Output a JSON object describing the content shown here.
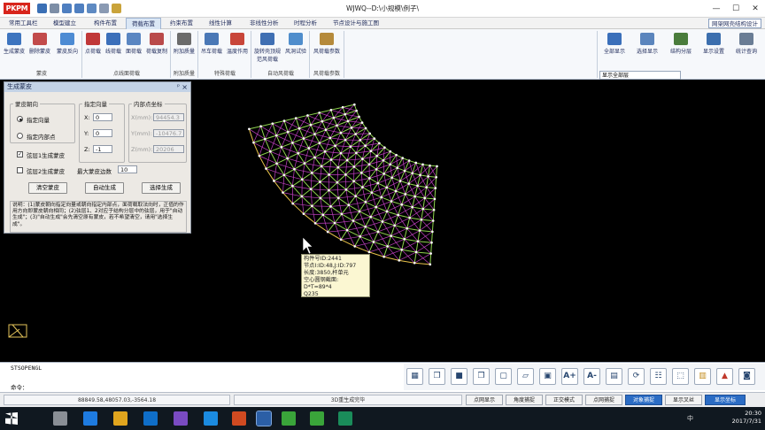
{
  "app": {
    "logo_text": "PKPM",
    "title": "WJWQ--D:\\小规模\\例子\\",
    "min": "—",
    "max": "☐",
    "close": "✕"
  },
  "menu": {
    "tabs": [
      "常用工具栏",
      "模型建立",
      "构件布置",
      "荷载布置",
      "约束布置",
      "线性计算",
      "非线性分析",
      "时程分析",
      "节点设计与施工图"
    ],
    "right_label": "网架网壳结构设计"
  },
  "ribbon": {
    "buttons": [
      {
        "label": "生成蒙皮",
        "icon": "skin-generate-icon"
      },
      {
        "label": "删除蒙皮",
        "icon": "skin-delete-icon"
      },
      {
        "label": "蒙皮反向",
        "icon": "skin-reverse-icon"
      },
      {
        "label": "点荷载",
        "icon": "point-load-icon"
      },
      {
        "label": "线荷载",
        "icon": "line-load-icon"
      },
      {
        "label": "面荷载",
        "icon": "area-load-icon"
      },
      {
        "label": "荷载复制",
        "icon": "load-copy-icon"
      },
      {
        "label": "附加质量",
        "icon": "mass-icon"
      },
      {
        "label": "吊车荷载",
        "icon": "crane-load-icon"
      },
      {
        "label": "温度作用",
        "icon": "temperature-icon"
      },
      {
        "label": "旋转壳顶规范风荷载",
        "icon": "wind-shell-icon"
      },
      {
        "label": "风洞试验",
        "icon": "wind-tunnel-icon"
      },
      {
        "label": "风荷载参数",
        "icon": "wind-param-icon"
      }
    ],
    "groups": [
      "蒙皮",
      "点线面荷载",
      "附加质量",
      "特殊荷载",
      "自动风荷载",
      "风荷载参数"
    ],
    "right_buttons": [
      {
        "label": "全部显示",
        "icon": "show-all-icon"
      },
      {
        "label": "选择显示",
        "icon": "select-show-icon"
      },
      {
        "label": "结构分层",
        "icon": "layer-icon"
      },
      {
        "label": "显示设置",
        "icon": "display-settings-icon"
      },
      {
        "label": "统计查询",
        "icon": "stats-icon"
      }
    ],
    "display_combo": "显示全部层"
  },
  "dialog": {
    "title": "生成蒙皮",
    "pin": "ᵖ",
    "close": "×",
    "direction_group": "蒙皮朝向",
    "opt_specified_dir": "指定向量",
    "opt_inner_point": "指定内部点",
    "vector_group": "指定向量",
    "x_label": "X:",
    "x_value": "0",
    "y_label": "Y:",
    "y_value": "0",
    "z_label": "Z:",
    "z_value": "-1",
    "inner_group": "内部点坐标",
    "ix_label": "X(mm):",
    "ix_value": "94454.3",
    "iy_label": "Y(mm):",
    "iy_value": "-10476.7",
    "iz_label": "Z(mm):",
    "iz_value": "20206",
    "chk_layer1": "弦层1生成蒙皮",
    "chk_layer2": "弦层2生成蒙皮",
    "max_edges_label": "最大蒙皮边数",
    "max_edges_value": "10",
    "btn_clear": "清空蒙皮",
    "btn_auto": "自动生成",
    "btn_select": "选择生成",
    "note": "说明：(1)蒙皮朝向指定向量或朝向指定内部点，面荷载取法向时，正值的作用方向即蒙皮朝向相同；(2)弦层1、2对应于结构分层中的弦层，用于\"自动生成\"；(3)\"自动生成\"会先清空原有蒙皮，若不希望清空，请用\"选择生成\"。"
  },
  "tooltip": {
    "line1": "构件号ID:2441",
    "line2": "节点I:ID:48,J:ID:797",
    "line3": "长度:3850,杆单元",
    "line4": "空心圆钢截面: D*T=89*4",
    "line5": "Q235"
  },
  "command": {
    "history": "STSOPENGL",
    "prompt": "命令："
  },
  "status": {
    "coords": "88849.58,48057.03,-3564.18",
    "message": "3D重生成完毕",
    "buttons": [
      "点网显示",
      "角度捕捉",
      "正交模式",
      "点网捕捉",
      "对象捕捉",
      "显示叉丝",
      "显示坐标"
    ],
    "active": [
      "对象捕捉",
      "显示坐标"
    ]
  },
  "taskbar": {
    "time": "20:30",
    "date": "2017/7/31",
    "lang": "中"
  },
  "colors": {
    "ribbon_bg": "#f6f8fb",
    "accent_blue": "#2b6cc4",
    "mesh_green": "#8fd14f",
    "mesh_magenta": "#c040c0",
    "mesh_node": "#ffffff",
    "tooltip_bg": "#fbf7d2"
  }
}
